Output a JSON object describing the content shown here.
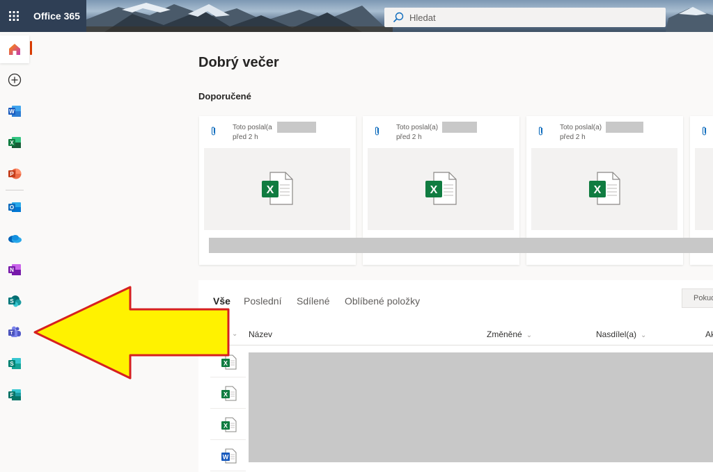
{
  "topbar": {
    "brand": "Office 365",
    "search_placeholder": "Hledat"
  },
  "rail": {
    "items": [
      {
        "name": "home",
        "icon": "home-icon",
        "active": true
      },
      {
        "name": "create",
        "icon": "plus-circle-icon"
      },
      {
        "name": "word",
        "icon": "word-icon",
        "letter": "W",
        "color": "#185abd"
      },
      {
        "name": "excel",
        "icon": "excel-icon",
        "letter": "X",
        "color": "#107c41"
      },
      {
        "name": "powerpoint",
        "icon": "powerpoint-icon",
        "letter": "P",
        "color": "#c43e1c"
      },
      {
        "name": "outlook",
        "icon": "outlook-icon",
        "letter": "O",
        "color": "#0f6cbd"
      },
      {
        "name": "onedrive",
        "icon": "onedrive-icon",
        "color": "#0364b8"
      },
      {
        "name": "onenote",
        "icon": "onenote-icon",
        "letter": "N",
        "color": "#7719aa"
      },
      {
        "name": "sharepoint",
        "icon": "sharepoint-icon",
        "letter": "S",
        "color": "#03787c"
      },
      {
        "name": "teams",
        "icon": "teams-icon",
        "color": "#5059c9"
      },
      {
        "name": "sway",
        "icon": "sway-icon",
        "letter": "S",
        "color": "#008272"
      },
      {
        "name": "forms",
        "icon": "forms-icon",
        "letter": "F",
        "color": "#077568"
      }
    ],
    "accent_color": "#d83b01"
  },
  "main": {
    "greeting": "Dobrý večer",
    "recommended_title": "Doporučené",
    "cards": [
      {
        "sender": "Toto poslal(a",
        "time": "před 2 h",
        "file_icon": "excel-file-icon"
      },
      {
        "sender": "Toto poslal(a)",
        "time": "před 2 h",
        "file_icon": "excel-file-icon"
      },
      {
        "sender": "Toto poslal(a)",
        "time": "před 2 h",
        "file_icon": "excel-file-icon"
      }
    ],
    "tabs": [
      "Vše",
      "Poslední",
      "Sdílené",
      "Oblíbené položky"
    ],
    "filter_button": "Pokud",
    "columns": {
      "name": "Název",
      "modified": "Změněné",
      "shared_by": "Nasdílel(a)",
      "activity": "Ak"
    },
    "rows": [
      {
        "file_icon": "excel-file-icon"
      },
      {
        "file_icon": "excel-file-icon"
      },
      {
        "file_icon": "excel-file-icon"
      },
      {
        "file_icon": "word-file-icon"
      }
    ]
  },
  "overlay": {
    "arrow_color": "#fff200",
    "arrow_outline": "#d62020"
  }
}
